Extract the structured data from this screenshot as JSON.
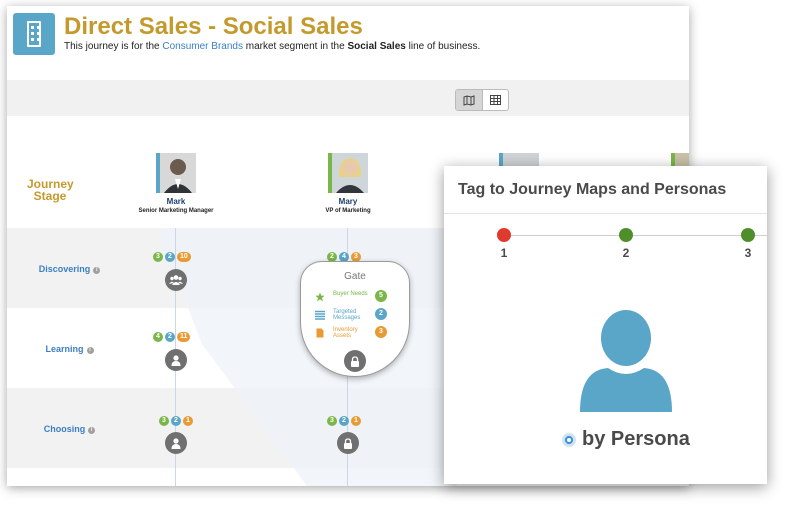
{
  "header": {
    "title": "Direct Sales - Social Sales",
    "subtitle_prefix": "This journey is for the ",
    "segment": "Consumer Brands",
    "subtitle_middle": " market segment in the ",
    "line_of_business": "Social Sales",
    "subtitle_suffix": " line of business."
  },
  "view_toggle": {
    "active": "map",
    "options": [
      "map-view-icon",
      "grid-view-icon"
    ]
  },
  "journey_stage_label": "Journey Stage",
  "personas": [
    {
      "name": "Mark",
      "role": "Senior Marketing Manager",
      "icon": "man-avatar"
    },
    {
      "name": "Mary",
      "role": "VP of Marketing",
      "icon": "woman-avatar"
    }
  ],
  "stages": [
    {
      "label": "Discovering",
      "mark_badges": [
        "3",
        "2",
        "10"
      ],
      "mary_badges": [
        "2",
        "4",
        "3"
      ]
    },
    {
      "label": "Learning",
      "mark_badges": [
        "4",
        "2",
        "11"
      ],
      "mary_badges": []
    },
    {
      "label": "Choosing",
      "mark_badges": [
        "3",
        "2",
        "1"
      ],
      "mary_badges": [
        "3",
        "2",
        "1"
      ]
    }
  ],
  "gate": {
    "title": "Gate",
    "items": [
      {
        "label": "Buyer Needs",
        "count": "5",
        "icon": "star-icon",
        "color": "#7ab648"
      },
      {
        "label": "Targeted Messages",
        "count": "2",
        "icon": "list-icon",
        "color": "#5aa6c8"
      },
      {
        "label": "Inventory Assets",
        "count": "3",
        "icon": "document-icon",
        "color": "#e89b35"
      }
    ]
  },
  "overlay": {
    "title": "Tag to Journey Maps and Personas",
    "steps": [
      {
        "label": "1",
        "color": "#e0392d"
      },
      {
        "label": "2",
        "color": "#4e8f2c"
      },
      {
        "label": "3",
        "color": "#4e8f2c"
      }
    ],
    "option_label": "by Persona"
  },
  "colors": {
    "title_gold": "#c49a2c",
    "link_blue": "#3b7fc4",
    "badge_green": "#7ab648",
    "badge_blue": "#5aa6c8",
    "badge_orange": "#e89b35",
    "persona_icon_blue": "#5aa6c8"
  }
}
